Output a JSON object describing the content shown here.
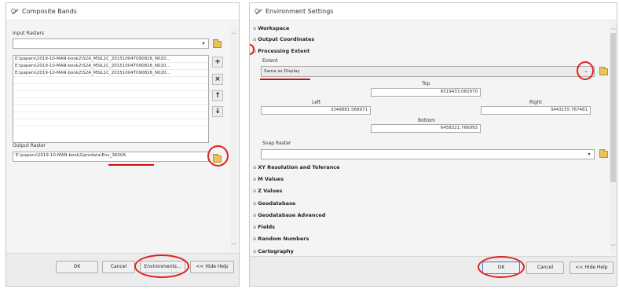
{
  "left_window": {
    "title": "Composite Bands",
    "input_rasters_label": "Input Rasters",
    "input_items": [
      "E:\\papers\\2019-10-MAN-book2\\S2A_MSIL1C_20151004T090826_N020...",
      "E:\\papers\\2019-10-MAN-book2\\S2A_MSIL1C_20151004T090826_N020...",
      "E:\\papers\\2019-10-MAN-book2\\S2A_MSIL1C_20151004T090826_N020..."
    ],
    "side_buttons": [
      "+",
      "×",
      "↑",
      "↓"
    ],
    "output_raster_label": "Output Raster",
    "output_raster_value": "E:\\papers\\2019-10-MAN-book2\\prodata\\Env_3600A",
    "buttons": {
      "ok": "OK",
      "cancel": "Cancel",
      "environments": "Environments...",
      "hide_help": "<< Hide Help"
    }
  },
  "right_window": {
    "title": "Environment Settings",
    "sections_top": [
      "Workspace",
      "Output Coordinates",
      "Processing Extent"
    ],
    "extent_label": "Extent",
    "extent_value": "Same as Display",
    "top_label": "Top",
    "top_value": "6519433.082970",
    "left_label": "Left",
    "left_value": "3349881.568971",
    "right_label": "Right",
    "right_value": "3443155.767481",
    "bottom_label": "Bottom",
    "bottom_value": "6458321.766993",
    "snap_raster_label": "Snap Raster",
    "sections_bottom": [
      "XY Resolution and Tolerance",
      "M Values",
      "Z Values",
      "Geodatabase",
      "Geodatabase Advanced",
      "Fields",
      "Random Numbers",
      "Cartography"
    ],
    "buttons": {
      "ok": "OK",
      "cancel": "Cancel",
      "hide_help": "<< Hide Help"
    }
  },
  "colors": {
    "annotation_red": "#e02020",
    "window_bg": "#f4f4f4",
    "folder_yellow": "#e8c25a"
  }
}
